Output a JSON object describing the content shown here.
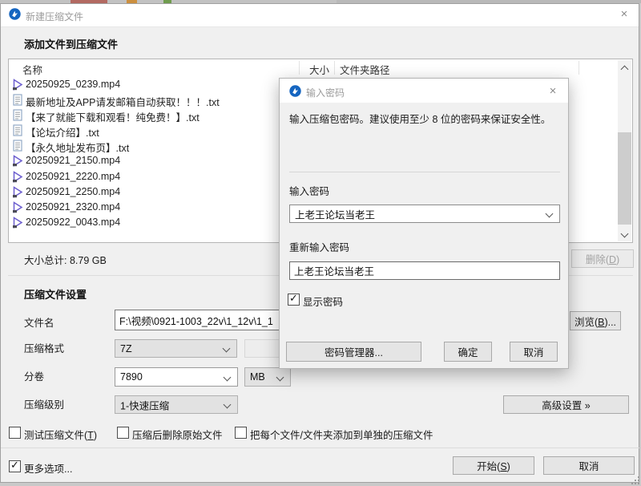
{
  "window": {
    "title": "新建压缩文件",
    "close_glyph": "×",
    "section_add": "添加文件到压缩文件",
    "list": {
      "columns": [
        "名称",
        "大小",
        "文件夹路径"
      ],
      "files": [
        {
          "name": "20250925_0239.mp4",
          "type": "mp4"
        },
        {
          "name": "最新地址及APP请发邮箱自动获取！！！.txt",
          "type": "txt"
        },
        {
          "name": "【来了就能下载和观看！纯免费！】.txt",
          "type": "txt"
        },
        {
          "name": "【论坛介绍】.txt",
          "type": "txt"
        },
        {
          "name": "【永久地址发布页】.txt",
          "type": "txt"
        },
        {
          "name": "20250921_2150.mp4",
          "type": "mp4"
        },
        {
          "name": "20250921_2220.mp4",
          "type": "mp4"
        },
        {
          "name": "20250921_2250.mp4",
          "type": "mp4"
        },
        {
          "name": "20250921_2320.mp4",
          "type": "mp4"
        },
        {
          "name": "20250922_0043.mp4",
          "type": "mp4"
        }
      ]
    },
    "total_size": "大小总计: 8.79 GB",
    "delete_button": {
      "pre": "删除(",
      "key": "D",
      "post": ")"
    },
    "section_settings": "压缩文件设置",
    "fields": {
      "filename_label": "文件名",
      "filename_value": "F:\\视频\\0921-1003_22v\\1_12v\\1_1",
      "browse_button": {
        "pre": "浏览(",
        "key": "B",
        "post": ")..."
      },
      "format_label": "压缩格式",
      "format_value": "7Z",
      "volume_label": "分卷",
      "volume_value": "7890",
      "volume_unit": "MB",
      "level_label": "压缩级别",
      "level_value": "1-快速压缩",
      "advanced_button": "高级设置 »"
    },
    "options": {
      "test": {
        "pre": "测试压缩文件(",
        "key": "T",
        "post": ")",
        "checked": false
      },
      "delete_after": {
        "label": "压缩后删除原始文件",
        "checked": false
      },
      "separate": {
        "label": "把每个文件/文件夹添加到单独的压缩文件",
        "checked": false
      },
      "more": {
        "label": "更多选项...",
        "checked": true
      }
    },
    "footer": {
      "start_button": {
        "pre": "开始(",
        "key": "S",
        "post": ")"
      },
      "cancel_label": "取消"
    }
  },
  "dialog": {
    "title": "输入密码",
    "close_glyph": "×",
    "message": "输入压缩包密码。建议使用至少 8 位的密码来保证安全性。",
    "password_label": "输入密码",
    "password_value": "上老王论坛当老王",
    "confirm_label": "重新输入密码",
    "confirm_value": "上老王论坛当老王",
    "show_password_label": "显示密码",
    "manager_button": "密码管理器...",
    "ok_button": "确定",
    "cancel_button": "取消"
  },
  "icons": {
    "check_glyph": "✓",
    "accent_color": "#1565c0",
    "video_icon_color": "#6c5ecf",
    "text_icon_color": "#93a9c6"
  }
}
